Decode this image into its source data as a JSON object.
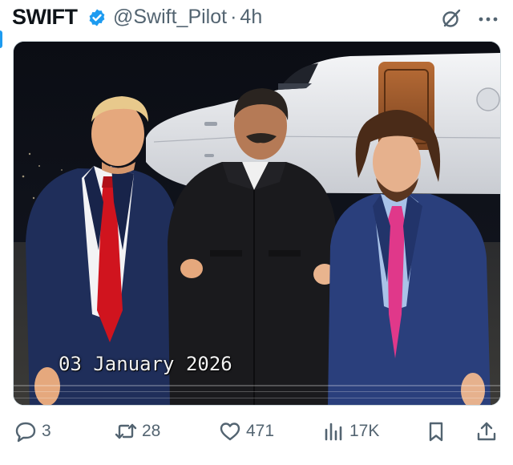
{
  "post": {
    "author_name": "SWIFT",
    "handle": "@Swift_Pilot",
    "separator": "·",
    "time": "4h",
    "verified_icon": "verified-badge-icon",
    "header_icons": [
      "grok-icon",
      "more-icon"
    ]
  },
  "media": {
    "date_stamp": "03 January 2026",
    "description_colors": {
      "background": "#0c0f18",
      "jet": "#e9ebee",
      "suit_navy": "#1f2e5a",
      "red_tie": "#d0141e",
      "pink_tie": "#e0388a",
      "black_jacket": "#1a1a1d"
    }
  },
  "actions": {
    "reply": {
      "icon": "reply-icon",
      "count": "3"
    },
    "repost": {
      "icon": "repost-icon",
      "count": "28"
    },
    "like": {
      "icon": "heart-icon",
      "count": "471"
    },
    "views": {
      "icon": "views-icon",
      "count": "17K"
    },
    "bookmark": {
      "icon": "bookmark-icon"
    },
    "share": {
      "icon": "share-icon"
    }
  },
  "colors": {
    "accent": "#1d9bf0",
    "secondary_text": "#536471",
    "primary_text": "#0f1419"
  }
}
